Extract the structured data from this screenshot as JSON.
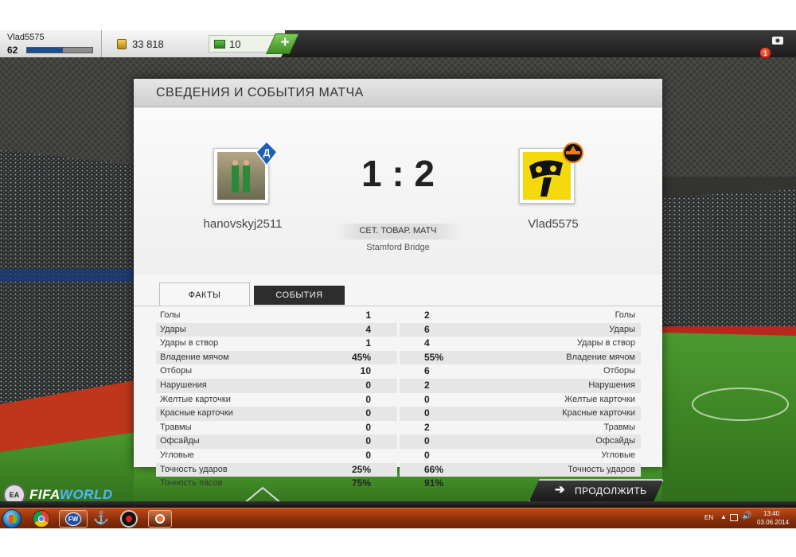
{
  "topbar": {
    "username": "Vlad5575",
    "level": "62",
    "xp_fraction": 0.55,
    "coins": "33 818",
    "fifa_points": "10",
    "add_points_label": "+",
    "notifications": "1"
  },
  "panel": {
    "title": "СВЕДЕНИЯ И СОБЫТИЯ МАТЧА"
  },
  "match": {
    "home_team": "hanovskyj2511",
    "away_team": "Vlad5575",
    "score": "1 : 2",
    "match_type": "СЕТ. ТОВАР. МАТЧ",
    "stadium": "Stamford Bridge"
  },
  "tabs": {
    "facts": "ФАКТЫ",
    "events": "СОБЫТИЯ"
  },
  "stats": [
    {
      "label": "Голы",
      "home": "1",
      "away": "2"
    },
    {
      "label": "Удары",
      "home": "4",
      "away": "6"
    },
    {
      "label": "Удары в створ",
      "home": "1",
      "away": "4"
    },
    {
      "label": "Владение мячом",
      "home": "45%",
      "away": "55%"
    },
    {
      "label": "Отборы",
      "home": "10",
      "away": "6"
    },
    {
      "label": "Нарушения",
      "home": "0",
      "away": "2"
    },
    {
      "label": "Желтые карточки",
      "home": "0",
      "away": "0"
    },
    {
      "label": "Красные карточки",
      "home": "0",
      "away": "0"
    },
    {
      "label": "Травмы",
      "home": "0",
      "away": "2"
    },
    {
      "label": "Офсайды",
      "home": "0",
      "away": "0"
    },
    {
      "label": "Угловые",
      "home": "0",
      "away": "0"
    },
    {
      "label": "Точность ударов",
      "home": "25%",
      "away": "66%"
    },
    {
      "label": "Точность пасов",
      "home": "75%",
      "away": "91%"
    }
  ],
  "continue_label": "ПРОДОЛЖИТЬ",
  "logo": {
    "ea": "EA",
    "fifa": "FIFA",
    "world": "WORLD"
  },
  "taskbar": {
    "language": "EN",
    "time": "13:40",
    "date": "03.06.2014",
    "fw_label": "FW"
  },
  "colors": {
    "accent_green": "#3f8f24",
    "panel_bg": "#f5f5f5",
    "dark_tab": "#2d2d2d",
    "taskbar": "#8a2f0b"
  }
}
